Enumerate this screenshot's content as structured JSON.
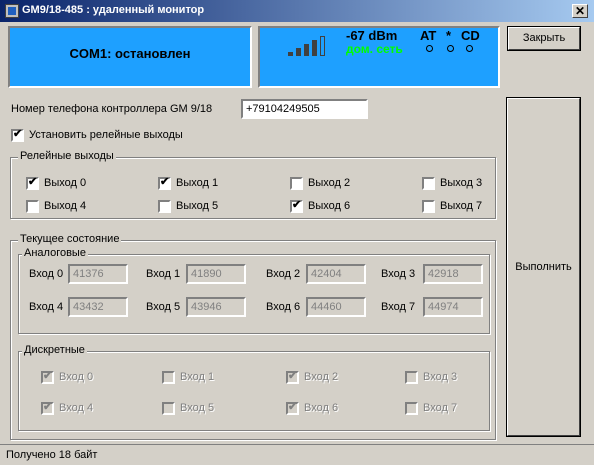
{
  "window": {
    "title": "GM9/18-485 : удаленный монитор",
    "close_glyph": "✕"
  },
  "status_panel": {
    "text": "COM1: остановлен"
  },
  "signal_panel": {
    "level": "-67 dBm",
    "network": "дом. сеть",
    "flags": [
      "AT",
      "*",
      "CD"
    ],
    "accent_color": "#1ea0ff",
    "network_color": "#00ff00",
    "signal_bars_filled": 4,
    "signal_bars_total": 5
  },
  "close_button": {
    "label": "Закрыть"
  },
  "execute_button": {
    "label": "Выполнить"
  },
  "phone": {
    "label": "Номер телефона контроллера GM 9/18",
    "value": "+79104249505"
  },
  "set_relays": {
    "label": "Установить релейные выходы",
    "checked": true
  },
  "relays": {
    "title": "Релейные выходы",
    "outputs": [
      {
        "label": "Выход 0",
        "checked": true
      },
      {
        "label": "Выход 1",
        "checked": true
      },
      {
        "label": "Выход 2",
        "checked": false
      },
      {
        "label": "Выход 3",
        "checked": false
      },
      {
        "label": "Выход 4",
        "checked": false
      },
      {
        "label": "Выход 5",
        "checked": false
      },
      {
        "label": "Выход 6",
        "checked": true
      },
      {
        "label": "Выход 7",
        "checked": false
      }
    ]
  },
  "current_state": {
    "title": "Текущее состояние",
    "analog": {
      "title": "Аналоговые",
      "inputs": [
        {
          "label": "Вход 0",
          "value": "41376"
        },
        {
          "label": "Вход 1",
          "value": "41890"
        },
        {
          "label": "Вход 2",
          "value": "42404"
        },
        {
          "label": "Вход 3",
          "value": "42918"
        },
        {
          "label": "Вход 4",
          "value": "43432"
        },
        {
          "label": "Вход 5",
          "value": "43946"
        },
        {
          "label": "Вход 6",
          "value": "44460"
        },
        {
          "label": "Вход 7",
          "value": "44974"
        }
      ]
    },
    "discrete": {
      "title": "Дискретные",
      "inputs": [
        {
          "label": "Вход 0",
          "checked": true
        },
        {
          "label": "Вход 1",
          "checked": false
        },
        {
          "label": "Вход 2",
          "checked": true
        },
        {
          "label": "Вход 3",
          "checked": false
        },
        {
          "label": "Вход 4",
          "checked": true
        },
        {
          "label": "Вход 5",
          "checked": false
        },
        {
          "label": "Вход 6",
          "checked": true
        },
        {
          "label": "Вход 7",
          "checked": false
        }
      ]
    }
  },
  "statusbar": {
    "text": "Получено 18 байт"
  },
  "check_glyph": "✔"
}
